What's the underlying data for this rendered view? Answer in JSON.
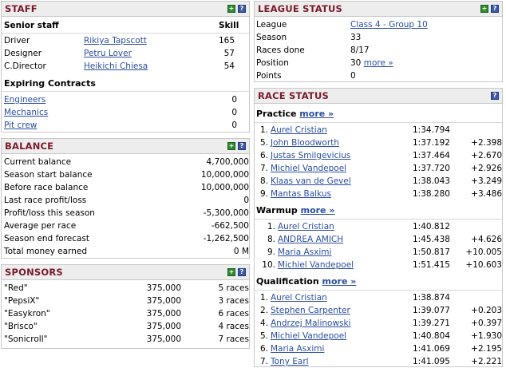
{
  "staff": {
    "title": "STAFF",
    "col_staff": "Senior staff",
    "col_skill": "Skill",
    "rows": [
      {
        "role": "Driver",
        "name": "Rikiya Tapscott",
        "skill": "165"
      },
      {
        "role": "Designer",
        "name": "Petru Lover",
        "skill": "57"
      },
      {
        "role": "C.Director",
        "name": "Heikichi Chiesa",
        "skill": "54"
      }
    ],
    "expiring_title": "Expiring Contracts",
    "expiring": [
      {
        "name": "Engineers",
        "value": "0"
      },
      {
        "name": "Mechanics",
        "value": "0"
      },
      {
        "name": "Pit crew",
        "value": "0"
      }
    ]
  },
  "balance": {
    "title": "BALANCE",
    "rows": [
      {
        "label": "Current balance",
        "value": "4,700,000"
      },
      {
        "label": "Season start balance",
        "value": "10,000,000"
      },
      {
        "label": "Before race balance",
        "value": "10,000,000"
      },
      {
        "label": "Last race profit/loss",
        "value": "0"
      },
      {
        "label": "Profit/loss this season",
        "value": "-5,300,000"
      },
      {
        "label": "Average per race",
        "value": "-662,500"
      },
      {
        "label": "Season end forecast",
        "value": "-1,262,500"
      },
      {
        "label": "Total money earned",
        "value": "0 M"
      }
    ]
  },
  "sponsors": {
    "title": "SPONSORS",
    "rows": [
      {
        "name": "\"Red\"",
        "amount": "375,000",
        "races": "5 races"
      },
      {
        "name": "\"PepsiX\"",
        "amount": "375,000",
        "races": "3 races"
      },
      {
        "name": "\"Easykron\"",
        "amount": "375,000",
        "races": "6 races"
      },
      {
        "name": "\"Brisco\"",
        "amount": "375,000",
        "races": "4 races"
      },
      {
        "name": "\"Sonicroll\"",
        "amount": "375,000",
        "races": "7 races"
      }
    ]
  },
  "league": {
    "title": "LEAGUE STATUS",
    "rows": [
      {
        "label": "League",
        "value": "Class 4 - Group 10",
        "link": true
      },
      {
        "label": "Season",
        "value": "33"
      },
      {
        "label": "Races done",
        "value": "8/17"
      },
      {
        "label": "Position",
        "value": "30",
        "more": "more »"
      },
      {
        "label": "Points",
        "value": "0"
      }
    ]
  },
  "race": {
    "title": "RACE STATUS",
    "more": "more »",
    "practice": {
      "title": "Practice",
      "rows": [
        {
          "pos": "1.",
          "name": "Aurel Cristian",
          "time": "1:34.794",
          "gap": ""
        },
        {
          "pos": "5.",
          "name": "John Bloodworth",
          "time": "1:37.192",
          "gap": "+2.398"
        },
        {
          "pos": "6.",
          "name": "Justas Smilgevicius",
          "time": "1:37.464",
          "gap": "+2.670"
        },
        {
          "pos": "7.",
          "name": "Michiel Vandepoel",
          "time": "1:37.720",
          "gap": "+2.926"
        },
        {
          "pos": "8.",
          "name": "Klaas van de Gevel",
          "time": "1:38.043",
          "gap": "+3.249"
        },
        {
          "pos": "9.",
          "name": "Mantas Balkus",
          "time": "1:38.280",
          "gap": "+3.486"
        }
      ]
    },
    "warmup": {
      "title": "Warmup",
      "rows": [
        {
          "pos": "1.",
          "name": "Aurel Cristian",
          "time": "1:40.812",
          "gap": ""
        },
        {
          "pos": "8.",
          "name": "ANDREA AMICH",
          "time": "1:45.438",
          "gap": "+4.626"
        },
        {
          "pos": "9.",
          "name": "Maria Asximi",
          "time": "1:50.817",
          "gap": "+10.005"
        },
        {
          "pos": "10.",
          "name": "Michiel Vandepoel",
          "time": "1:51.415",
          "gap": "+10.603"
        }
      ]
    },
    "qualification": {
      "title": "Qualification",
      "rows": [
        {
          "pos": "1.",
          "name": "Aurel Cristian",
          "time": "1:38.874",
          "gap": ""
        },
        {
          "pos": "2.",
          "name": "Stephen Carpenter",
          "time": "1:39.077",
          "gap": "+0.203"
        },
        {
          "pos": "4.",
          "name": "Andrzej Malinowski",
          "time": "1:39.271",
          "gap": "+0.397"
        },
        {
          "pos": "5.",
          "name": "Michiel Vandepoel",
          "time": "1:40.804",
          "gap": "+1.930"
        },
        {
          "pos": "6.",
          "name": "Maria Asximi",
          "time": "1:41.069",
          "gap": "+2.195"
        },
        {
          "pos": "7.",
          "name": "Tony Earl",
          "time": "1:41.095",
          "gap": "+2.221"
        }
      ]
    }
  },
  "icons": {
    "expand": "expand-icon",
    "help": "help-icon"
  }
}
